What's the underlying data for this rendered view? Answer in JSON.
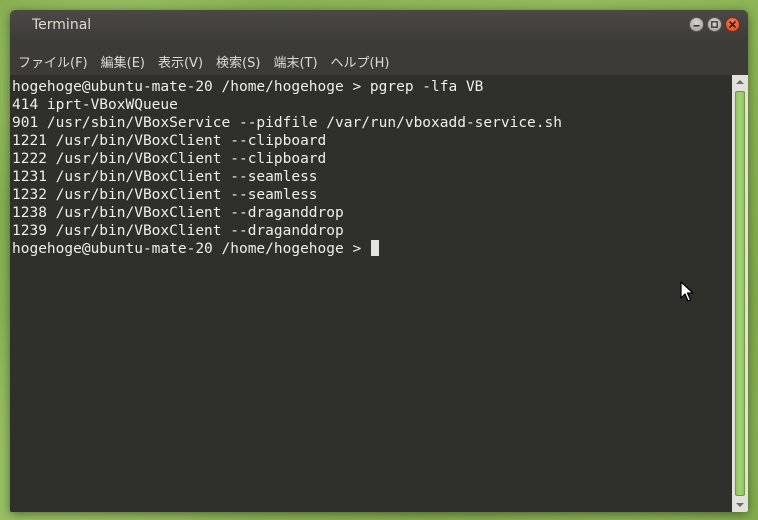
{
  "window": {
    "title": "Terminal"
  },
  "menubar": {
    "items": [
      {
        "label": "ファイル(F)"
      },
      {
        "label": "編集(E)"
      },
      {
        "label": "表示(V)"
      },
      {
        "label": "検索(S)"
      },
      {
        "label": "端末(T)"
      },
      {
        "label": "ヘルプ(H)"
      }
    ]
  },
  "terminal": {
    "lines": [
      "hogehoge@ubuntu-mate-20 /home/hogehoge > pgrep -lfa VB",
      "414 iprt-VBoxWQueue",
      "901 /usr/sbin/VBoxService --pidfile /var/run/vboxadd-service.sh",
      "1221 /usr/bin/VBoxClient --clipboard",
      "1222 /usr/bin/VBoxClient --clipboard",
      "1231 /usr/bin/VBoxClient --seamless",
      "1232 /usr/bin/VBoxClient --seamless",
      "1238 /usr/bin/VBoxClient --draganddrop",
      "1239 /usr/bin/VBoxClient --draganddrop"
    ],
    "prompt": "hogehoge@ubuntu-mate-20 /home/hogehoge > "
  },
  "colors": {
    "terminal_bg": "#2f2f2b",
    "terminal_fg": "#eeeeec",
    "titlebar": "#3c3b37",
    "close_button": "#e0552f",
    "scrollbar_thumb": "#9ccc6b"
  },
  "icons": {
    "minimize": "minimize-icon",
    "maximize": "maximize-icon",
    "close": "close-icon",
    "scroll_up": "arrow-up-icon",
    "scroll_down": "arrow-down-icon",
    "pointer": "mouse-pointer-icon"
  }
}
